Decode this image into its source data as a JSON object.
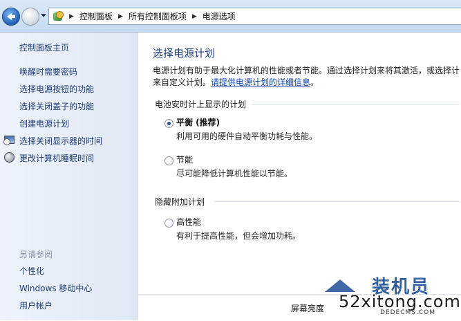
{
  "breadcrumb": [
    "控制面板",
    "所有控制面板项",
    "电源选项"
  ],
  "sidebar": {
    "home": "控制面板主页",
    "links": [
      "唤醒时需要密码",
      "选择电源按钮的功能",
      "选择关闭盖子的功能",
      "创建电源计划",
      "选择关闭显示器的时间",
      "更改计算机睡眠时间"
    ],
    "see_also_heading": "另请参阅",
    "see_also": [
      "个性化",
      "Windows 移动中心",
      "用户帐户"
    ]
  },
  "main": {
    "title": "选择电源计划",
    "intro_line1": "电源计划有助于最大化计算机的性能或者节能。通过选择计划来将其激活，或选择计",
    "intro_line2_prefix": "来自定义计划。",
    "intro_link": "请提供电源计划的详细信息",
    "intro_suffix": "。",
    "battery_group": "电池安时计上显示的计划",
    "plans": [
      {
        "name": "平衡 (推荐)",
        "desc": "利用可用的硬件自动平衡功耗与性能。",
        "selected": true
      },
      {
        "name": "节能",
        "desc": "尽可能降低计算机性能以节能。",
        "selected": false
      }
    ],
    "hidden_group": "隐藏附加计划",
    "hidden_plans": [
      {
        "name": "高性能",
        "desc": "有利于提高性能，但会增加功耗。",
        "selected": false
      }
    ],
    "brightness_label": "屏幕亮度"
  },
  "watermark": {
    "brand": "装机员",
    "site": "52xitong.com",
    "sub": "DEDECMS.COM"
  },
  "colors": {
    "title": "#1e3d85",
    "link": "#1c3a72",
    "sidebar_bg": "#e6edf8"
  }
}
